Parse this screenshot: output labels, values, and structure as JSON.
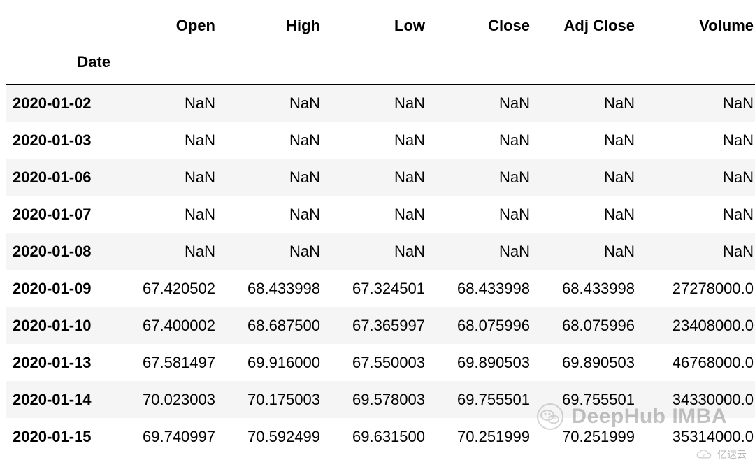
{
  "columns": {
    "index_name": "Date",
    "headers": [
      "Open",
      "High",
      "Low",
      "Close",
      "Adj Close",
      "Volume"
    ]
  },
  "rows": [
    {
      "date": "2020-01-02",
      "open": "NaN",
      "high": "NaN",
      "low": "NaN",
      "close": "NaN",
      "adj_close": "NaN",
      "volume": "NaN"
    },
    {
      "date": "2020-01-03",
      "open": "NaN",
      "high": "NaN",
      "low": "NaN",
      "close": "NaN",
      "adj_close": "NaN",
      "volume": "NaN"
    },
    {
      "date": "2020-01-06",
      "open": "NaN",
      "high": "NaN",
      "low": "NaN",
      "close": "NaN",
      "adj_close": "NaN",
      "volume": "NaN"
    },
    {
      "date": "2020-01-07",
      "open": "NaN",
      "high": "NaN",
      "low": "NaN",
      "close": "NaN",
      "adj_close": "NaN",
      "volume": "NaN"
    },
    {
      "date": "2020-01-08",
      "open": "NaN",
      "high": "NaN",
      "low": "NaN",
      "close": "NaN",
      "adj_close": "NaN",
      "volume": "NaN"
    },
    {
      "date": "2020-01-09",
      "open": "67.420502",
      "high": "68.433998",
      "low": "67.324501",
      "close": "68.433998",
      "adj_close": "68.433998",
      "volume": "27278000.0"
    },
    {
      "date": "2020-01-10",
      "open": "67.400002",
      "high": "68.687500",
      "low": "67.365997",
      "close": "68.075996",
      "adj_close": "68.075996",
      "volume": "23408000.0"
    },
    {
      "date": "2020-01-13",
      "open": "67.581497",
      "high": "69.916000",
      "low": "67.550003",
      "close": "69.890503",
      "adj_close": "69.890503",
      "volume": "46768000.0"
    },
    {
      "date": "2020-01-14",
      "open": "70.023003",
      "high": "70.175003",
      "low": "69.578003",
      "close": "69.755501",
      "adj_close": "69.755501",
      "volume": "34330000.0"
    },
    {
      "date": "2020-01-15",
      "open": "69.740997",
      "high": "70.592499",
      "low": "69.631500",
      "close": "70.251999",
      "adj_close": "70.251999",
      "volume": "35314000.0"
    }
  ],
  "watermark": {
    "brand": "DeepHub IMBA",
    "site": "亿速云"
  }
}
